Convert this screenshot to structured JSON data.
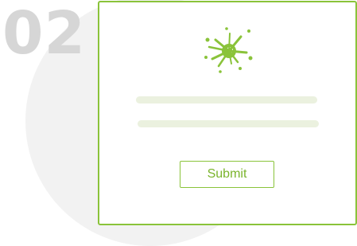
{
  "step": {
    "number": "02"
  },
  "form": {
    "submit_label": "Submit",
    "icon": "paint-splat-icon"
  },
  "colors": {
    "accent": "#8ac33a",
    "button_text": "#7ab42c",
    "placeholder_line": "#ebf1df",
    "number": "#d6d6d6",
    "background_circle": "#f2f2f2"
  }
}
